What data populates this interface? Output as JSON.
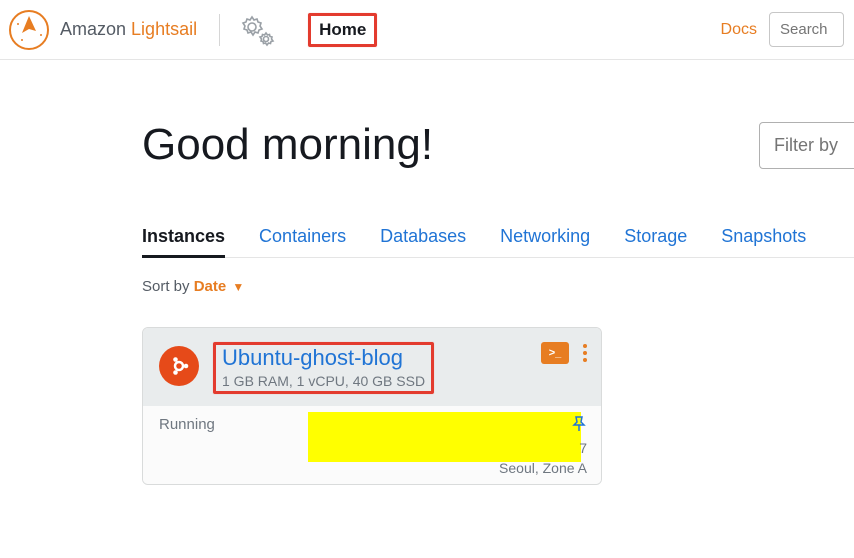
{
  "header": {
    "brand_prefix": "Amazon ",
    "brand_suffix": "Lightsail",
    "home_label": "Home",
    "docs_label": "Docs",
    "search_placeholder": "Search"
  },
  "main": {
    "greeting": "Good morning!",
    "filter_placeholder": "Filter by name",
    "tabs": [
      {
        "label": "Instances",
        "active": true
      },
      {
        "label": "Containers"
      },
      {
        "label": "Databases"
      },
      {
        "label": "Networking"
      },
      {
        "label": "Storage"
      },
      {
        "label": "Snapshots"
      }
    ],
    "sort": {
      "prefix": "Sort by ",
      "value": "Date"
    }
  },
  "instance": {
    "name": "Ubuntu-ghost-blog",
    "specs": "1 GB RAM, 1 vCPU, 40 GB SSD",
    "status": "Running",
    "ip_tail": "7",
    "region": "Seoul, Zone A",
    "os_icon": "ubuntu-icon",
    "terminal_label": ">_"
  }
}
